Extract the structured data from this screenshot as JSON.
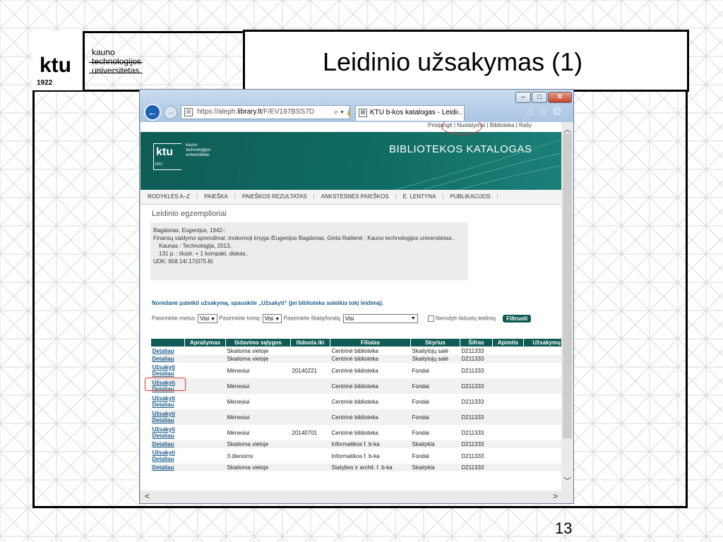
{
  "slide": {
    "title": "Leidinio užsakymas (1)",
    "page_number": "13",
    "logo": {
      "brand": "ktu",
      "year": "1922",
      "lines": [
        "kauno",
        "technologijos",
        "universitetas"
      ]
    }
  },
  "browser": {
    "address": {
      "prefix": "https://aleph.",
      "host": "library.lt",
      "path": "/F/EV197BSS7D",
      "tools": "⌕ ▾ 🔒 ↻"
    },
    "tab_title": "KTU b-kos katalogas - Leidi...",
    "tab_close": "×",
    "window_buttons": {
      "minimize": "–",
      "maximize": "□",
      "close": "✕"
    },
    "back_glyph": "←",
    "fwd_glyph": "→",
    "tool_glyphs": "⌂☆⚙"
  },
  "page": {
    "top_links": "Prisijungti | Nustatymai | Biblioteka | Rašy",
    "banner": {
      "logo_brand": "ktu",
      "logo_year": "1922",
      "logo_lines": [
        "kauno",
        "technologijos",
        "universitetas"
      ],
      "title": "BIBLIOTEKOS KATALOGAS"
    },
    "nav": [
      "RODYKLĖS A–Z",
      "PAIEŠKA",
      "PAIEŠKOS REZULTATAS",
      "ANKSTESNĖS PAIEŠKOS",
      "E. LENTYNA",
      "PUBLIKACIJOS"
    ],
    "heading": "Leidinio egzemplioriai",
    "record": [
      "Bagdonas, Eugenijus, 1942-:",
      "Finansų valdymo sprendimai :mokomoji knyga /Eugenijus Bagdonas, Ginta Railienė ; Kauno technologijos universitetas..",
      "Kaunas : Technologija, 2013..",
      "131 p. : iliustr. + 1 kompakt. diskas..",
      "UDK: 658.14/.17(075.8)"
    ],
    "instruction": "Norėdami pateikti užsakymą, spauskite „Užsakyti“ (jei biblioteka suteikia tokį leidimą).",
    "filters": {
      "year_label": "Pasirinkite metus:",
      "year_value": "Visi",
      "volume_label": "Pasirinkite tomą:",
      "volume_value": "Visi",
      "branch_label": "Pasirinkite filialą/fondą:",
      "branch_value": "Visi",
      "hide_label": "Nerodyti išduotų leidinių",
      "filter_button": "Filtruoti"
    },
    "table": {
      "headers": [
        "",
        "Aprašymas",
        "Išdavimo sąlygos",
        "Išduota iki",
        "Filialas",
        "Skyrius",
        "Šifras",
        "Apimtis",
        "Užsakymų s"
      ],
      "rows": [
        {
          "links": [
            "Detaliau"
          ],
          "aprasymas": "",
          "salygos": "Skaitoma vietoje",
          "iki": "",
          "filialas": "Centrinė biblioteka",
          "skyrius": "Skaitytojų salė",
          "sifras": "D211333"
        },
        {
          "links": [
            "Detaliau"
          ],
          "aprasymas": "",
          "salygos": "Skaitoma vietoje",
          "iki": "",
          "filialas": "Centrinė biblioteka",
          "skyrius": "Skaitytojų salė",
          "sifras": "D211333"
        },
        {
          "links": [
            "Užsakyti",
            "Detaliau"
          ],
          "aprasymas": "",
          "salygos": "Mėnesiui",
          "iki": "20140221",
          "filialas": "Centrinė biblioteka",
          "skyrius": "Fondai",
          "sifras": "D211333"
        },
        {
          "links": [
            "Užsakyti",
            "Detaliau"
          ],
          "aprasymas": "",
          "salygos": "Mėnesiui",
          "iki": "",
          "filialas": "Centrinė biblioteka",
          "skyrius": "Fondai",
          "sifras": "D211333"
        },
        {
          "links": [
            "Užsakyti",
            "Detaliau"
          ],
          "aprasymas": "",
          "salygos": "Mėnesiui",
          "iki": "",
          "filialas": "Centrinė biblioteka",
          "skyrius": "Fondai",
          "sifras": "D211333"
        },
        {
          "links": [
            "Užsakyti",
            "Detaliau"
          ],
          "aprasymas": "",
          "salygos": "Mėnesiui",
          "iki": "",
          "filialas": "Centrinė biblioteka",
          "skyrius": "Fondai",
          "sifras": "D211333"
        },
        {
          "links": [
            "Užsakyti",
            "Detaliau"
          ],
          "aprasymas": "",
          "salygos": "Mėnesiui",
          "iki": "20140701",
          "filialas": "Centrinė biblioteka",
          "skyrius": "Fondai",
          "sifras": "D211333"
        },
        {
          "links": [
            "Detaliau"
          ],
          "aprasymas": "",
          "salygos": "Skaitoma vietoje",
          "iki": "",
          "filialas": "Informatikos f. b-ka",
          "skyrius": "Skaitykla",
          "sifras": "D211333"
        },
        {
          "links": [
            "Užsakyti",
            "Detaliau"
          ],
          "aprasymas": "",
          "salygos": "3 dienoms",
          "iki": "",
          "filialas": "Informatikos f. b-ka",
          "skyrius": "Fondai",
          "sifras": "D211333"
        },
        {
          "links": [
            "Detaliau"
          ],
          "aprasymas": "",
          "salygos": "Skaitoma vietoje",
          "iki": "",
          "filialas": "Statybos ir archit. f. b-ka",
          "skyrius": "Skaitykla",
          "sifras": "D211333"
        }
      ]
    }
  },
  "colors": {
    "accent": "#0f5c56",
    "link": "#1a5c8a",
    "highlight": "#d23a2a"
  }
}
